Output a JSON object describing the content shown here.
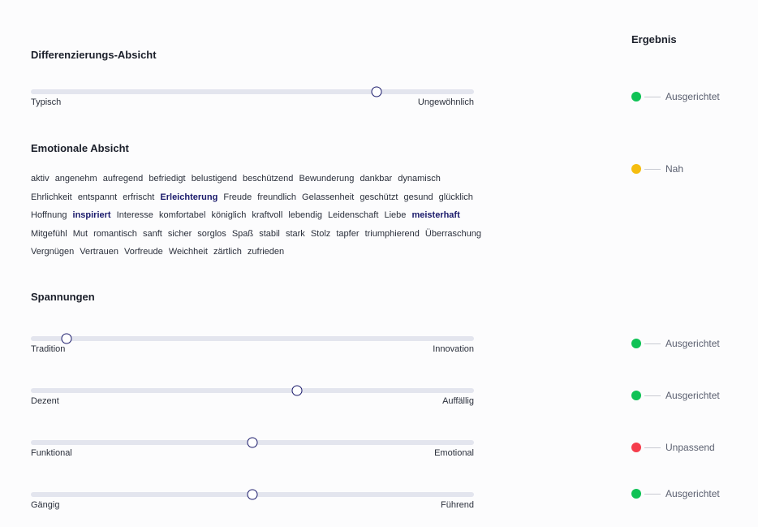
{
  "result_header": "Ergebnis",
  "differentiation": {
    "heading": "Differenzierungs-Absicht",
    "left_label": "Typisch",
    "right_label": "Ungewöhnlich",
    "value": 0.78
  },
  "emotional": {
    "heading": "Emotionale Absicht",
    "words": [
      {
        "text": "aktiv",
        "selected": false
      },
      {
        "text": "angenehm",
        "selected": false
      },
      {
        "text": "aufregend",
        "selected": false
      },
      {
        "text": "befriedigt",
        "selected": false
      },
      {
        "text": "belustigend",
        "selected": false
      },
      {
        "text": "beschützend",
        "selected": false
      },
      {
        "text": "Bewunderung",
        "selected": false
      },
      {
        "text": "dankbar",
        "selected": false
      },
      {
        "text": "dynamisch",
        "selected": false
      },
      {
        "text": "Ehrlichkeit",
        "selected": false
      },
      {
        "text": "entspannt",
        "selected": false
      },
      {
        "text": "erfrischt",
        "selected": false
      },
      {
        "text": "Erleichterung",
        "selected": true
      },
      {
        "text": "Freude",
        "selected": false
      },
      {
        "text": "freundlich",
        "selected": false
      },
      {
        "text": "Gelassenheit",
        "selected": false
      },
      {
        "text": "geschützt",
        "selected": false
      },
      {
        "text": "gesund",
        "selected": false
      },
      {
        "text": "glücklich",
        "selected": false
      },
      {
        "text": "Hoffnung",
        "selected": false
      },
      {
        "text": "inspiriert",
        "selected": true
      },
      {
        "text": "Interesse",
        "selected": false
      },
      {
        "text": "komfortabel",
        "selected": false
      },
      {
        "text": "königlich",
        "selected": false
      },
      {
        "text": "kraftvoll",
        "selected": false
      },
      {
        "text": "lebendig",
        "selected": false
      },
      {
        "text": "Leidenschaft",
        "selected": false
      },
      {
        "text": "Liebe",
        "selected": false
      },
      {
        "text": "meisterhaft",
        "selected": true
      },
      {
        "text": "Mitgefühl",
        "selected": false
      },
      {
        "text": "Mut",
        "selected": false
      },
      {
        "text": "romantisch",
        "selected": false
      },
      {
        "text": "sanft",
        "selected": false
      },
      {
        "text": "sicher",
        "selected": false
      },
      {
        "text": "sorglos",
        "selected": false
      },
      {
        "text": "Spaß",
        "selected": false
      },
      {
        "text": "stabil",
        "selected": false
      },
      {
        "text": "stark",
        "selected": false
      },
      {
        "text": "Stolz",
        "selected": false
      },
      {
        "text": "tapfer",
        "selected": false
      },
      {
        "text": "triumphierend",
        "selected": false
      },
      {
        "text": "Überraschung",
        "selected": false
      },
      {
        "text": "Vergnügen",
        "selected": false
      },
      {
        "text": "Vertrauen",
        "selected": false
      },
      {
        "text": "Vorfreude",
        "selected": false
      },
      {
        "text": "Weichheit",
        "selected": false
      },
      {
        "text": "zärtlich",
        "selected": false
      },
      {
        "text": "zufrieden",
        "selected": false
      }
    ]
  },
  "tensions": {
    "heading": "Spannungen",
    "sliders": [
      {
        "left_label": "Tradition",
        "right_label": "Innovation",
        "value": 0.08
      },
      {
        "left_label": "Dezent",
        "right_label": "Auffällig",
        "value": 0.6
      },
      {
        "left_label": "Funktional",
        "right_label": "Emotional",
        "value": 0.5
      },
      {
        "left_label": "Gängig",
        "right_label": "Führend",
        "value": 0.5
      }
    ]
  },
  "results": [
    {
      "label": "Ausgerichtet",
      "status": "green"
    },
    {
      "label": "Nah",
      "status": "yellow"
    },
    {
      "label": "Ausgerichtet",
      "status": "green"
    },
    {
      "label": "Ausgerichtet",
      "status": "green"
    },
    {
      "label": "Unpassend",
      "status": "red"
    },
    {
      "label": "Ausgerichtet",
      "status": "green"
    }
  ],
  "status_colors": {
    "green": "#0fc255",
    "yellow": "#f5bd0f",
    "red": "#f53d4c"
  }
}
